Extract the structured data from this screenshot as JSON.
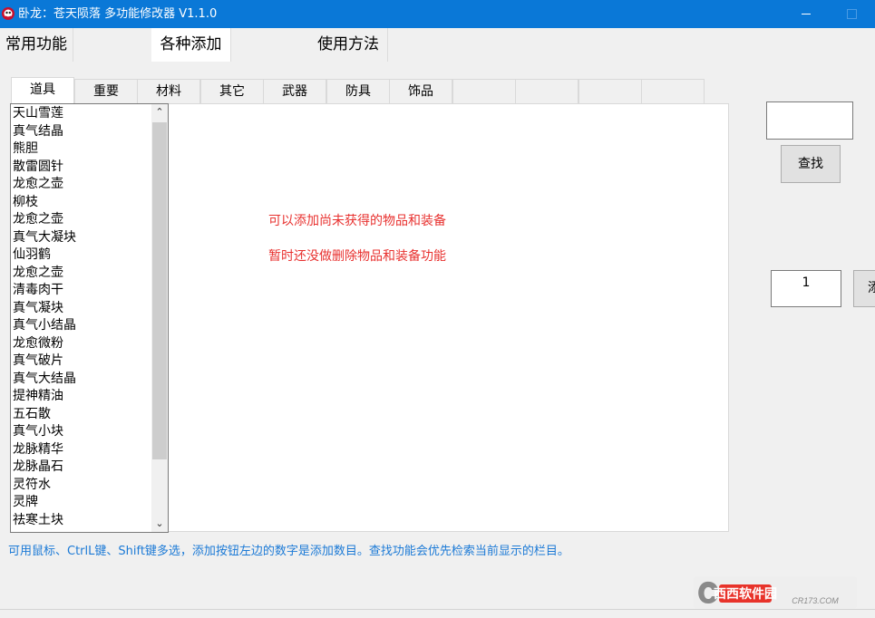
{
  "window": {
    "title": "卧龙：苍天陨落 多功能修改器 V1.1.0"
  },
  "main_tabs": [
    {
      "label": "常用功能"
    },
    {
      "label": "各种添加"
    },
    {
      "label": "使用方法"
    }
  ],
  "sub_tabs": [
    {
      "label": "道具"
    },
    {
      "label": "重要"
    },
    {
      "label": "材料"
    },
    {
      "label": "其它"
    },
    {
      "label": "武器"
    },
    {
      "label": "防具"
    },
    {
      "label": "饰品"
    },
    {
      "label": ""
    },
    {
      "label": ""
    },
    {
      "label": ""
    },
    {
      "label": ""
    }
  ],
  "item_list": [
    "天山雪莲",
    "真气结晶",
    "熊胆",
    "散雷圆针",
    "龙愈之壶",
    "柳枝",
    "龙愈之壶",
    "真气大凝块",
    "仙羽鹤",
    "龙愈之壶",
    "清毒肉干",
    "真气凝块",
    "真气小结晶",
    "龙愈微粉",
    "真气破片",
    "真气大结晶",
    "提神精油",
    "五石散",
    "真气小块",
    "龙脉精华",
    "龙脉晶石",
    "灵符水",
    "灵牌",
    "祛寒土块"
  ],
  "notes": {
    "line1": "可以添加尚未获得的物品和装备",
    "line2": "暂时还没做删除物品和装备功能"
  },
  "search": {
    "value": "",
    "button_label": "查找"
  },
  "quantity": {
    "value": "1",
    "add_button_label": "添"
  },
  "hint": "可用鼠标、CtrlL键、Shift键多选，添加按钮左边的数字是添加数目。查找功能会优先检索当前显示的栏目。",
  "watermark": {
    "text": "西西软件园",
    "subtext": "CR173.COM"
  },
  "colors": {
    "titlebar": "#0a78d7",
    "note_red": "#e8312f",
    "hint_blue": "#1c7ad6"
  }
}
